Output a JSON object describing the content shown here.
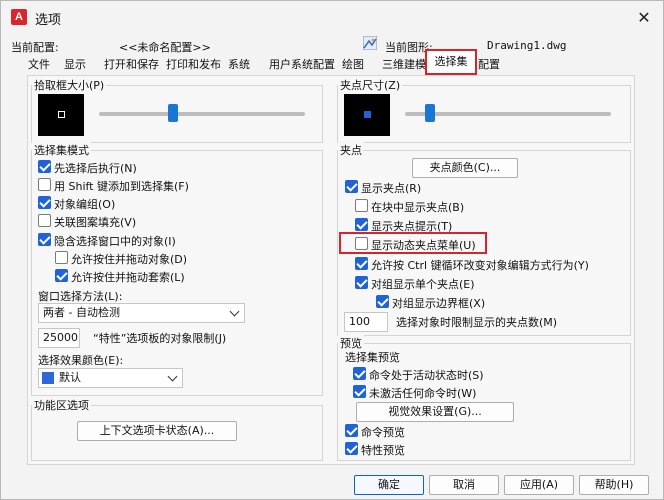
{
  "app": {
    "icon_text": "A",
    "title": "选项",
    "close": "✕"
  },
  "header": {
    "profile_label": "当前配置:",
    "profile_value": "<<未命名配置>>",
    "drawing_label": "当前图形:",
    "drawing_value": "Drawing1.dwg"
  },
  "tabs": [
    "文件",
    "显示",
    "打开和保存",
    "打印和发布",
    "系统",
    "用户系统配置",
    "绘图",
    "三维建模",
    "选择集",
    "配置"
  ],
  "left": {
    "pickbox_title": "拾取框大小(P)",
    "pickbox_slider_fraction": 0.35,
    "mode_title": "选择集模式",
    "modes": [
      {
        "label": "先选择后执行(N)",
        "checked": true
      },
      {
        "label": "用 Shift 键添加到选择集(F)",
        "checked": false
      },
      {
        "label": "对象编组(O)",
        "checked": true
      },
      {
        "label": "关联图案填充(V)",
        "checked": false
      },
      {
        "label": "隐含选择窗口中的对象(I)",
        "checked": true
      },
      {
        "label": "允许按住并拖动对象(D)",
        "checked": false
      },
      {
        "label": "允许按住并拖动套索(L)",
        "checked": true
      }
    ],
    "window_method_label": "窗口选择方法(L):",
    "window_method_value": "两者 - 自动检测",
    "limit_value": "25000",
    "limit_label": "“特性”选项板的对象限制(J)",
    "effect_color_label": "选择效果颜色(E):",
    "effect_color_value": "默认",
    "effect_color_swatch": "#2f67d8",
    "ribbon_title": "功能区选项",
    "ribbon_button": "上下文选项卡状态(A)..."
  },
  "right": {
    "gripsize_title": "夹点尺寸(Z)",
    "gripsize_slider_fraction": 0.1,
    "grips_title": "夹点",
    "grip_color_button": "夹点颜色(C)...",
    "grips": [
      {
        "label": "显示夹点(R)",
        "checked": true
      },
      {
        "label": "在块中显示夹点(B)",
        "checked": false
      },
      {
        "label": "显示夹点提示(T)",
        "checked": true
      },
      {
        "label": "显示动态夹点菜单(U)",
        "checked": false
      },
      {
        "label": "允许按 Ctrl 键循环改变对象编辑方式行为(Y)",
        "checked": true
      },
      {
        "label": "对组显示单个夹点(E)",
        "checked": true
      },
      {
        "label": "对组显示边界框(X)",
        "checked": true
      }
    ],
    "grip_limit_value": "100",
    "grip_limit_label": "选择对象时限制显示的夹点数(M)",
    "preview_title": "预览",
    "preview_sub_title": "选择集预览",
    "previews": [
      {
        "label": "命令处于活动状态时(S)",
        "checked": true
      },
      {
        "label": "未激活任何命令时(W)",
        "checked": true
      }
    ],
    "visual_effects_button": "视觉效果设置(G)...",
    "cmd_preview_label": "命令预览",
    "cmd_preview_checked": true,
    "prop_preview_label": "特性预览",
    "prop_preview_checked": true
  },
  "footer": {
    "ok": "确定",
    "cancel": "取消",
    "apply": "应用(A)",
    "help": "帮助(H)"
  },
  "colors": {
    "accent": "#1f63d6",
    "highlight": "#d9232b"
  }
}
